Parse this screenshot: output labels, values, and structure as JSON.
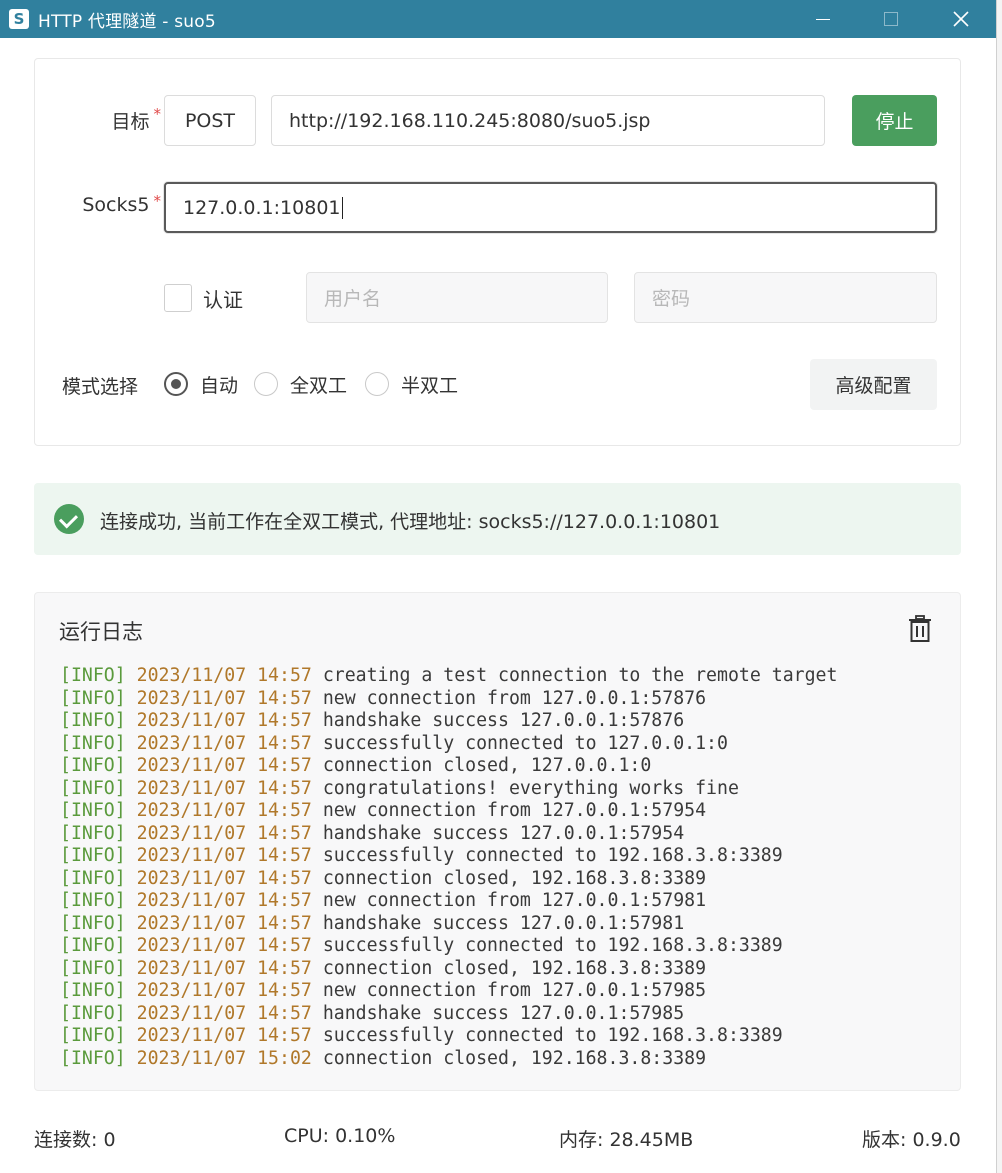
{
  "window": {
    "title": "HTTP 代理隧道 - suo5",
    "app_icon": "S",
    "controls": {
      "minimize": "minimize-icon",
      "maximize": "maximize-icon",
      "close": "close-icon"
    }
  },
  "form": {
    "target_label": "目标",
    "required_mark": "*",
    "method": "POST",
    "url": "http://192.168.110.245:8080/suo5.jsp",
    "stop_label": "停止",
    "socks_label": "Socks5",
    "socks_value": "127.0.0.1:10801",
    "auth_label": "认证",
    "auth_checked": false,
    "username_placeholder": "用户名",
    "password_placeholder": "密码",
    "mode_label": "模式选择",
    "modes": [
      {
        "label": "自动",
        "selected": true
      },
      {
        "label": "全双工",
        "selected": false
      },
      {
        "label": "半双工",
        "selected": false
      }
    ],
    "advanced_label": "高级配置"
  },
  "banner": {
    "text": "连接成功, 当前工作在全双工模式, 代理地址: socks5://127.0.0.1:10801",
    "icon": "check-circle-icon",
    "color": "#4a9e5e"
  },
  "log": {
    "title": "运行日志",
    "clear_icon": "trash-icon",
    "lines": [
      {
        "level": "[INFO]",
        "time": "2023/11/07 14:57",
        "message": "creating a test connection to the remote target"
      },
      {
        "level": "[INFO]",
        "time": "2023/11/07 14:57",
        "message": "new connection from 127.0.0.1:57876"
      },
      {
        "level": "[INFO]",
        "time": "2023/11/07 14:57",
        "message": "handshake success 127.0.0.1:57876"
      },
      {
        "level": "[INFO]",
        "time": "2023/11/07 14:57",
        "message": "successfully connected to 127.0.0.1:0"
      },
      {
        "level": "[INFO]",
        "time": "2023/11/07 14:57",
        "message": "connection closed, 127.0.0.1:0"
      },
      {
        "level": "[INFO]",
        "time": "2023/11/07 14:57",
        "message": "congratulations! everything works fine"
      },
      {
        "level": "[INFO]",
        "time": "2023/11/07 14:57",
        "message": "new connection from 127.0.0.1:57954"
      },
      {
        "level": "[INFO]",
        "time": "2023/11/07 14:57",
        "message": "handshake success 127.0.0.1:57954"
      },
      {
        "level": "[INFO]",
        "time": "2023/11/07 14:57",
        "message": "successfully connected to 192.168.3.8:3389"
      },
      {
        "level": "[INFO]",
        "time": "2023/11/07 14:57",
        "message": "connection closed, 192.168.3.8:3389"
      },
      {
        "level": "[INFO]",
        "time": "2023/11/07 14:57",
        "message": "new connection from 127.0.0.1:57981"
      },
      {
        "level": "[INFO]",
        "time": "2023/11/07 14:57",
        "message": "handshake success 127.0.0.1:57981"
      },
      {
        "level": "[INFO]",
        "time": "2023/11/07 14:57",
        "message": "successfully connected to 192.168.3.8:3389"
      },
      {
        "level": "[INFO]",
        "time": "2023/11/07 14:57",
        "message": "connection closed, 192.168.3.8:3389"
      },
      {
        "level": "[INFO]",
        "time": "2023/11/07 14:57",
        "message": "new connection from 127.0.0.1:57985"
      },
      {
        "level": "[INFO]",
        "time": "2023/11/07 14:57",
        "message": "handshake success 127.0.0.1:57985"
      },
      {
        "level": "[INFO]",
        "time": "2023/11/07 14:57",
        "message": "successfully connected to 192.168.3.8:3389"
      },
      {
        "level": "[INFO]",
        "time": "2023/11/07 15:02",
        "message": "connection closed, 192.168.3.8:3389"
      }
    ]
  },
  "status": {
    "connections": "连接数: 0",
    "cpu": "CPU: 0.10%",
    "memory": "内存: 28.45MB",
    "version": "版本: 0.9.0"
  },
  "colors": {
    "titlebar": "#30809e",
    "primary_button": "#4a9e5e",
    "log_level": "#5a9a3c",
    "log_time": "#b0782a"
  }
}
